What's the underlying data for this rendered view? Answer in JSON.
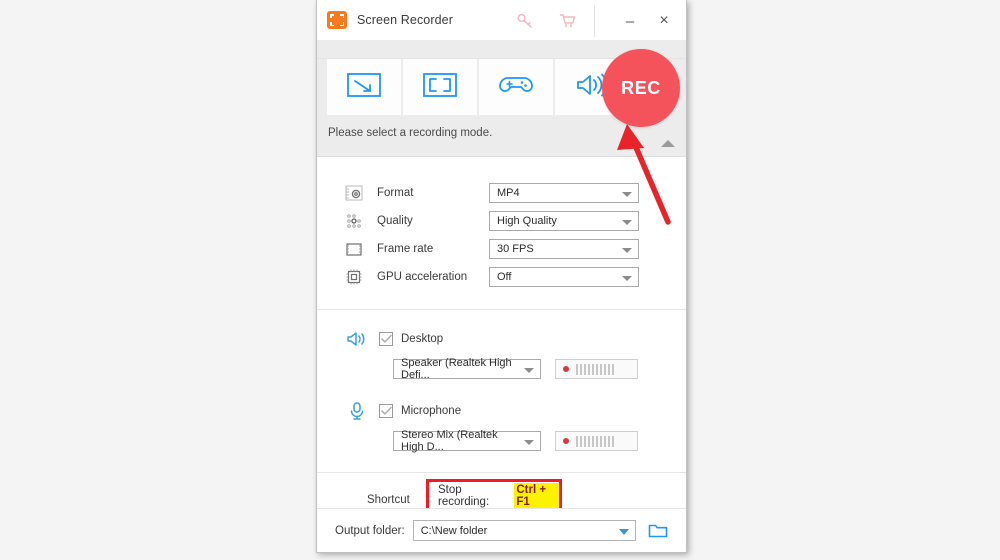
{
  "window": {
    "title": "Screen Recorder",
    "app_icon": "screen-recorder-logo-icon",
    "titlebar_icons": [
      "key-icon",
      "cart-icon"
    ],
    "minimize_label": "–",
    "close_label": "×"
  },
  "modes": [
    {
      "name": "custom-region",
      "icon": "region-select-icon"
    },
    {
      "name": "full-screen",
      "icon": "fullscreen-icon"
    },
    {
      "name": "game-recording",
      "icon": "gamepad-icon"
    },
    {
      "name": "audio-recording",
      "icon": "speaker-icon"
    }
  ],
  "rec_button": {
    "label": "REC",
    "color": "#f4535b"
  },
  "hint": {
    "text": "Please select a recording mode.",
    "collapse_icon": "chevron-up-icon"
  },
  "settings": {
    "rows": [
      {
        "icon": "format-gear-icon",
        "label": "Format",
        "value": "MP4"
      },
      {
        "icon": "quality-dots-icon",
        "label": "Quality",
        "value": "High Quality"
      },
      {
        "icon": "framerate-icon",
        "label": "Frame rate",
        "value": "30 FPS"
      },
      {
        "icon": "gpu-chip-icon",
        "label": "GPU acceleration",
        "value": "Off"
      }
    ]
  },
  "audio": {
    "desktop": {
      "icon": "speaker-icon",
      "label": "Desktop",
      "checked": true,
      "device": "Speaker (Realtek High Defi...",
      "meter_bars": 10
    },
    "microphone": {
      "icon": "microphone-icon",
      "label": "Microphone",
      "checked": true,
      "device": "Stereo Mix (Realtek High D...",
      "meter_bars": 10
    }
  },
  "shortcut": {
    "label": "Shortcut",
    "action_label": "Stop recording:",
    "keys": "Ctrl + F1",
    "highlight_color": "#fdf200",
    "box_border_color": "#ee1c25"
  },
  "output": {
    "label": "Output folder:",
    "path": "C:\\New folder",
    "browse_icon": "folder-icon"
  },
  "annotation": {
    "arrow": "red-arrow-pointing-to-rec"
  }
}
